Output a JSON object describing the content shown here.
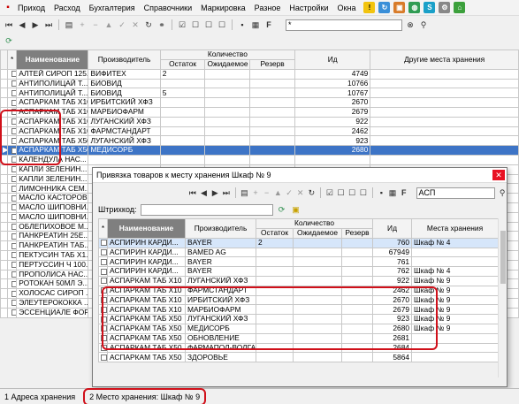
{
  "menu": {
    "items": [
      "Приход",
      "Расход",
      "Бухгалтерия",
      "Справочники",
      "Маркировка",
      "Разное",
      "Настройки",
      "Окна"
    ]
  },
  "main_toolbar": {
    "search_value": "*"
  },
  "main_table": {
    "headers": {
      "name": "Наименование",
      "maker": "Производитель",
      "qty": "Количество",
      "stock": "Остаток",
      "expected": "Ожидаемое",
      "reserve": "Резерв",
      "id": "Ид",
      "places": "Другие места хранения"
    },
    "rows": [
      {
        "name": "АЛТЕЙ СИРОП 125...",
        "maker": "ВИФИТЕХ",
        "stock": "2",
        "id": "4749"
      },
      {
        "name": "АНТИПОЛИЦАЙ Т...",
        "maker": "БИОВИД",
        "stock": "",
        "id": "10766"
      },
      {
        "name": "АНТИПОЛИЦАЙ Т...",
        "maker": "БИОВИД",
        "stock": "5",
        "id": "10767"
      },
      {
        "name": "АСПАРКАМ ТАБ X10",
        "maker": "ИРБИТСКИЙ ХФЗ",
        "stock": "",
        "id": "2670"
      },
      {
        "name": "АСПАРКАМ ТАБ X10",
        "maker": "МАРБИОФАРМ",
        "stock": "",
        "id": "2679"
      },
      {
        "name": "АСПАРКАМ ТАБ X10",
        "maker": "ЛУГАНСКИЙ ХФЗ",
        "stock": "",
        "id": "922"
      },
      {
        "name": "АСПАРКАМ ТАБ X10",
        "maker": "ФАРМСТАНДАРТ",
        "stock": "",
        "id": "2462"
      },
      {
        "name": "АСПАРКАМ ТАБ X50",
        "maker": "ЛУГАНСКИЙ ХФЗ",
        "stock": "",
        "id": "923"
      },
      {
        "name": "АСПАРКАМ ТАБ X50",
        "maker": "МЕДИСОРБ",
        "stock": "",
        "id": "2680"
      },
      {
        "name": "КАЛЕНДУЛА НАС...",
        "maker": "",
        "stock": "",
        "id": ""
      },
      {
        "name": "КАПЛИ ЗЕЛЕНИН...",
        "maker": "",
        "stock": "",
        "id": ""
      },
      {
        "name": "КАПЛИ ЗЕЛЕНИН...",
        "maker": "",
        "stock": "",
        "id": ""
      },
      {
        "name": "ЛИМОННИКА СЕМ...",
        "maker": "",
        "stock": "",
        "id": ""
      },
      {
        "name": "МАСЛО КАСТОРОВ...",
        "maker": "",
        "stock": "",
        "id": ""
      },
      {
        "name": "МАСЛО ШИПОВНИ...",
        "maker": "",
        "stock": "",
        "id": ""
      },
      {
        "name": "МАСЛО ШИПОВНИ...",
        "maker": "",
        "stock": "",
        "id": ""
      },
      {
        "name": "ОБЛЕПИХОВОЕ М...",
        "maker": "",
        "stock": "",
        "id": ""
      },
      {
        "name": "ПАНКРЕАТИН 25Е...",
        "maker": "",
        "stock": "",
        "id": ""
      },
      {
        "name": "ПАНКРЕАТИН ТАБ...",
        "maker": "",
        "stock": "",
        "id": ""
      },
      {
        "name": "ПЕКТУСИН ТАБ X1...",
        "maker": "",
        "stock": "",
        "id": ""
      },
      {
        "name": "ПЕРТУССИН Ч 100...",
        "maker": "",
        "stock": "",
        "id": ""
      },
      {
        "name": "ПРОПОЛИСА НАС...",
        "maker": "",
        "stock": "",
        "id": ""
      },
      {
        "name": "РОТОКАН 50МЛ Э...",
        "maker": "",
        "stock": "",
        "id": ""
      },
      {
        "name": "ХОЛОСАС СИРОП ...",
        "maker": "",
        "stock": "",
        "id": ""
      },
      {
        "name": "ЭЛЕУТЕРОКОККА ...",
        "maker": "",
        "stock": "",
        "id": ""
      },
      {
        "name": "ЭССЕНЦИАЛЕ ФОР...",
        "maker": "",
        "stock": "",
        "id": ""
      }
    ]
  },
  "dialog": {
    "title": "Привязка товаров к месту хранения Шкаф № 9",
    "close_label": "✕",
    "search_value": "АСП",
    "barcode_label": "Штрихкод:",
    "headers": {
      "name": "Наименование",
      "maker": "Производитель",
      "qty": "Количество",
      "stock": "Остаток",
      "expected": "Ожидаемое",
      "reserve": "Резерв",
      "id": "Ид",
      "places": "Места хранения"
    },
    "rows": [
      {
        "name": "АСПИРИН КАРДИ...",
        "maker": "BAYER",
        "stock": "2",
        "id": "760",
        "place": "Шкаф № 4"
      },
      {
        "name": "АСПИРИН КАРДИ...",
        "maker": "BAMED AG",
        "stock": "",
        "id": "67949",
        "place": ""
      },
      {
        "name": "АСПИРИН КАРДИ...",
        "maker": "BAYER",
        "stock": "",
        "id": "761",
        "place": ""
      },
      {
        "name": "АСПИРИН КАРДИ...",
        "maker": "BAYER",
        "stock": "",
        "id": "762",
        "place": "Шкаф № 4"
      },
      {
        "name": "АСПАРКАМ ТАБ X10",
        "maker": "ЛУГАНСКИЙ ХФЗ",
        "stock": "",
        "id": "922",
        "place": "Шкаф № 9"
      },
      {
        "name": "АСПАРКАМ ТАБ X10",
        "maker": "ФАРМСТАНДАРТ",
        "stock": "",
        "id": "2462",
        "place": "Шкаф № 9"
      },
      {
        "name": "АСПАРКАМ ТАБ X10",
        "maker": "ИРБИТСКИЙ ХФЗ",
        "stock": "",
        "id": "2670",
        "place": "Шкаф № 9"
      },
      {
        "name": "АСПАРКАМ ТАБ X10",
        "maker": "МАРБИОФАРМ",
        "stock": "",
        "id": "2679",
        "place": "Шкаф № 9"
      },
      {
        "name": "АСПАРКАМ ТАБ X50",
        "maker": "ЛУГАНСКИЙ ХФЗ",
        "stock": "",
        "id": "923",
        "place": "Шкаф № 9"
      },
      {
        "name": "АСПАРКАМ ТАБ X50",
        "maker": "МЕДИСОРБ",
        "stock": "",
        "id": "2680",
        "place": "Шкаф № 9"
      },
      {
        "name": "АСПАРКАМ ТАБ X50",
        "maker": "ОБНОВЛЕНИЕ",
        "stock": "",
        "id": "2681",
        "place": ""
      },
      {
        "name": "АСПАРКАМ ТАБ X50",
        "maker": "ФАРМАПОЛ-ВОЛГА",
        "stock": "",
        "id": "2684",
        "place": ""
      },
      {
        "name": "АСПАРКАМ ТАБ X50",
        "maker": "ЗДОРОВЬЕ",
        "stock": "",
        "id": "5864",
        "place": ""
      }
    ]
  },
  "status": {
    "tab1": "1 Адреса хранения",
    "tab2": "2 Место хранения: Шкаф № 9"
  },
  "colors": {
    "accent": "#3d74c6",
    "highlight": "#d0101a",
    "close": "#e81123"
  }
}
